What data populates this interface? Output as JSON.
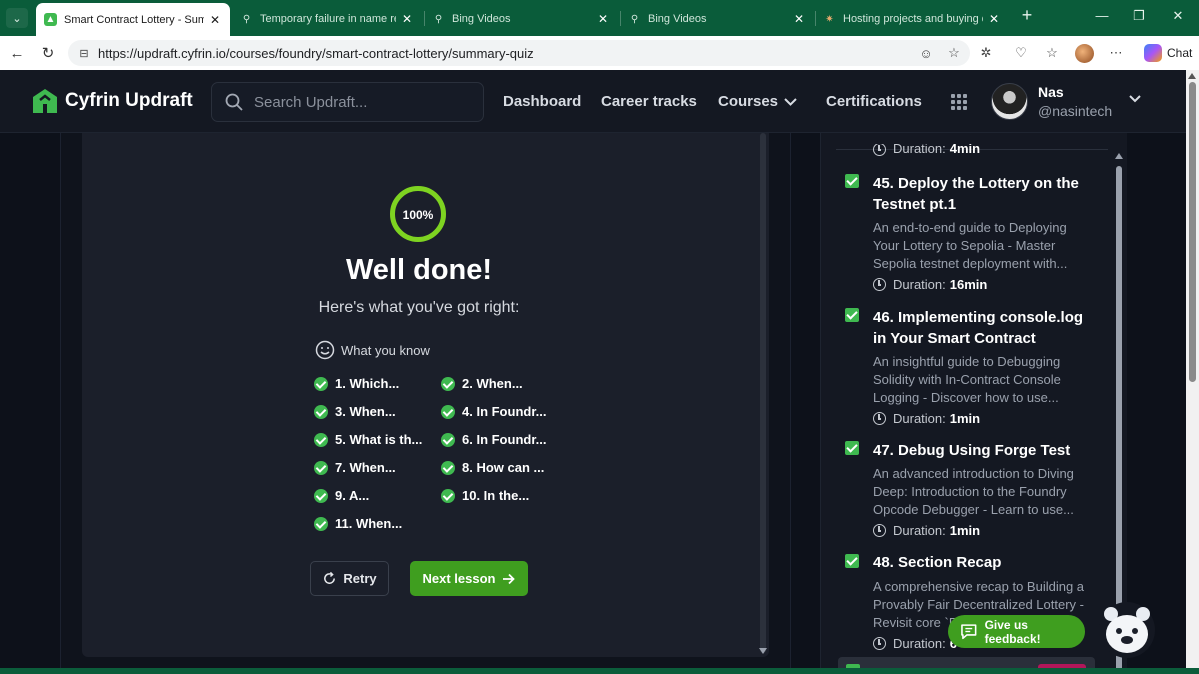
{
  "browser": {
    "tabs": [
      {
        "title": "Smart Contract Lottery - Summ",
        "active": true
      },
      {
        "title": "Temporary failure in name reso",
        "active": false
      },
      {
        "title": "Bing Videos",
        "active": false
      },
      {
        "title": "Bing Videos",
        "active": false
      },
      {
        "title": "Hosting projects and buying d",
        "active": false
      }
    ],
    "url": "https://updraft.cyfrin.io/courses/foundry/smart-contract-lottery/summary-quiz",
    "chat_label": "Chat"
  },
  "site": {
    "brand": "Cyfrin Updraft",
    "search_placeholder": "Search Updraft...",
    "nav": {
      "dashboard": "Dashboard",
      "career_tracks": "Career tracks",
      "courses": "Courses",
      "certifications": "Certifications"
    },
    "user": {
      "name": "Nas",
      "handle": "@nasintech"
    },
    "accent_color": "#3f9e1f"
  },
  "quiz": {
    "progress": "100%",
    "progress_fraction": 1.0,
    "heading": "Well done!",
    "subheading": "Here's what you've got right:",
    "section_label": "What you know",
    "items": [
      "1. Which...",
      "2. When...",
      "3. When...",
      "4. In Foundr...",
      "5. What is th...",
      "6. In Foundr...",
      "7. When...",
      "8. How can ...",
      "9. A...",
      "10. In the...",
      "11. When..."
    ],
    "retry_label": "Retry",
    "next_label": "Next lesson"
  },
  "sidebar": {
    "top_duration_label": "Duration:",
    "top_duration_value": "4min",
    "lessons": [
      {
        "title": "45. Deploy the Lottery on the Testnet pt.1",
        "desc": "An end-to-end guide to Deploying Your Lottery to Sepolia - Master Sepolia testnet deployment with...",
        "duration_label": "Duration:",
        "duration": "16min"
      },
      {
        "title": "46. Implementing console.log in Your Smart Contract",
        "desc": "An insightful guide to Debugging Solidity with In-Contract Console Logging - Discover how to use...",
        "duration_label": "Duration:",
        "duration": "1min"
      },
      {
        "title": "47. Debug Using Forge Test",
        "desc": "An advanced introduction to Diving Deep: Introduction to the Foundry Opcode Debugger - Learn to use...",
        "duration_label": "Duration:",
        "duration": "1min"
      },
      {
        "title": "48. Section Recap",
        "desc": "A comprehensive recap to Building a Provably Fair Decentralized Lottery - Revisit core `R",
        "duration_label": "Duration:",
        "duration": "6"
      }
    ],
    "feedback_label": "Give us feedback!"
  }
}
